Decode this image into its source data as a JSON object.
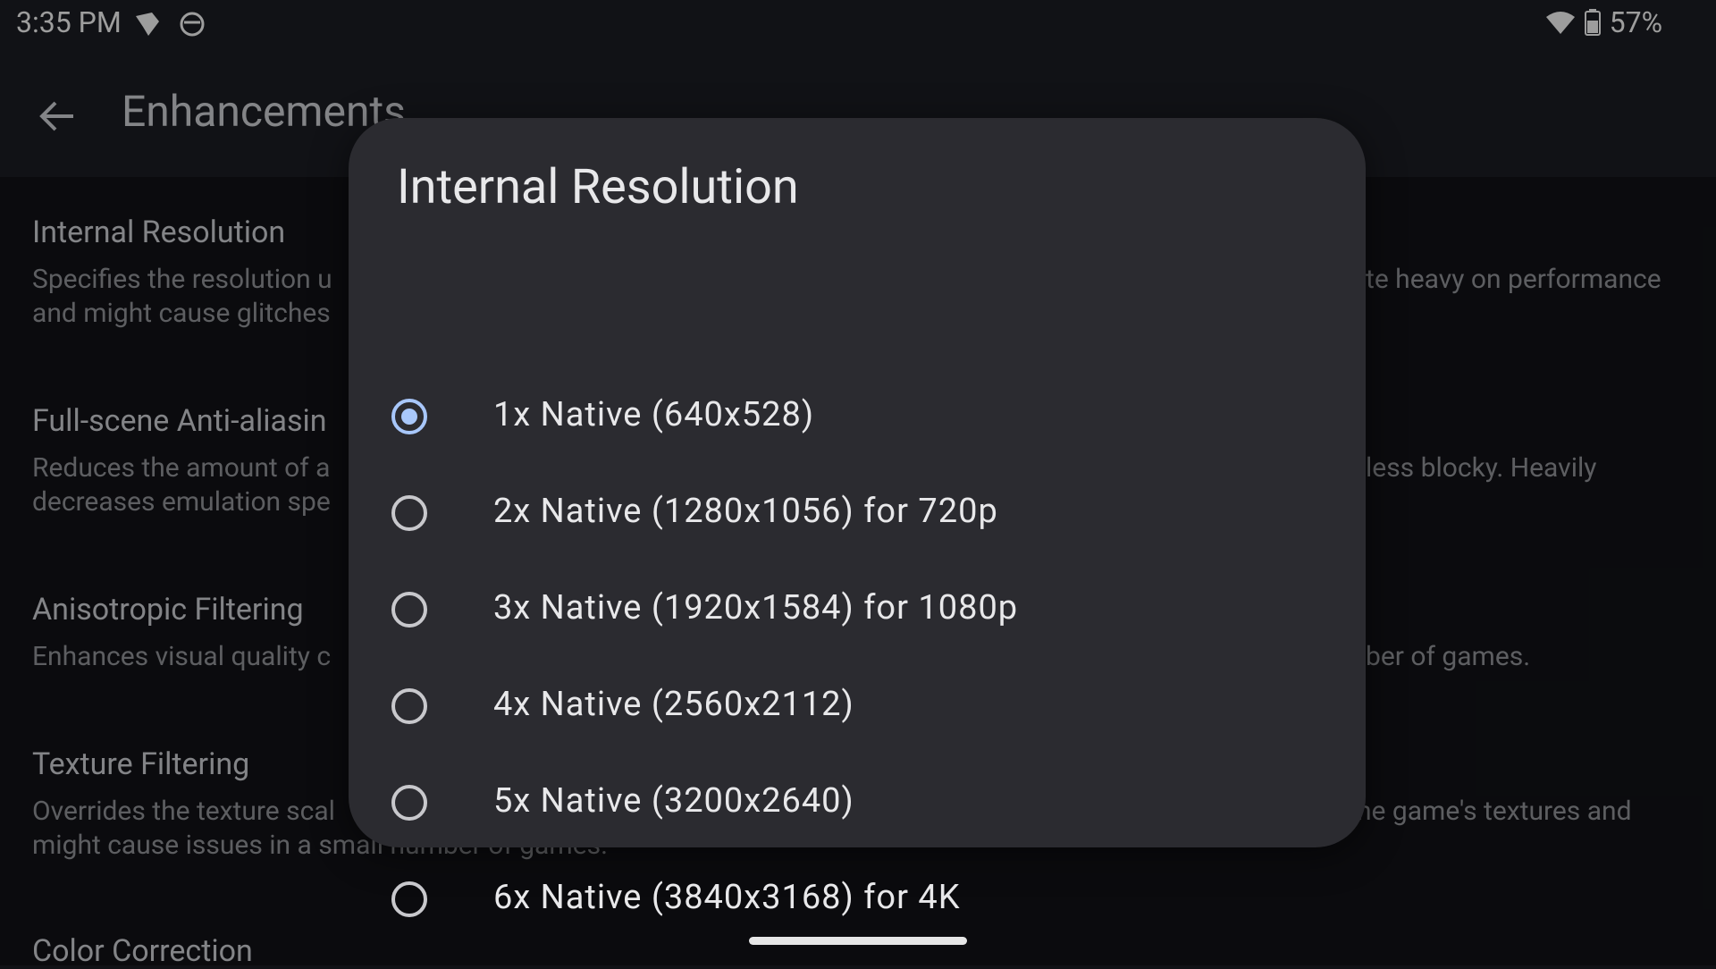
{
  "status": {
    "time": "3:35 PM",
    "battery": "57%",
    "icons": [
      "shield-heart-icon",
      "sync-face-icon",
      "wifi-icon",
      "battery-icon"
    ]
  },
  "appbar": {
    "title": "Enhancements"
  },
  "settings": [
    {
      "title": "Internal Resolution",
      "desc_left": [
        "Specifies the resolution u",
        "and might cause glitches"
      ],
      "desc_right": [
        "te heavy on performance",
        ""
      ]
    },
    {
      "title": "Full-scene Anti-aliasin",
      "desc_left": [
        "Reduces the amount of a",
        "decreases emulation spe"
      ],
      "desc_right": [
        "less blocky. Heavily",
        ""
      ]
    },
    {
      "title": "Anisotropic Filtering",
      "desc_left": [
        "Enhances visual quality c",
        ""
      ],
      "desc_right": [
        "ber of games.",
        ""
      ]
    },
    {
      "title": "Texture Filtering",
      "desc_left": [
        "Overrides the texture scal",
        "might cause issues in a small number of games."
      ],
      "desc_right": [
        "he game's textures and",
        ""
      ]
    },
    {
      "title": "Color Correction",
      "desc_left": [
        "",
        ""
      ],
      "desc_right": [
        "",
        ""
      ]
    }
  ],
  "dialog": {
    "title": "Internal Resolution",
    "selected_index": 0,
    "options": [
      "1x Native (640x528)",
      "2x Native (1280x1056) for 720p",
      "3x Native (1920x1584) for 1080p",
      "4x Native (2560x2112)",
      "5x Native (3200x2640)",
      "6x Native (3840x3168) for 4K"
    ]
  },
  "colors": {
    "accent": "#a8c7fa",
    "dialog_bg": "#2b2b30",
    "page_bg": "#111216"
  }
}
